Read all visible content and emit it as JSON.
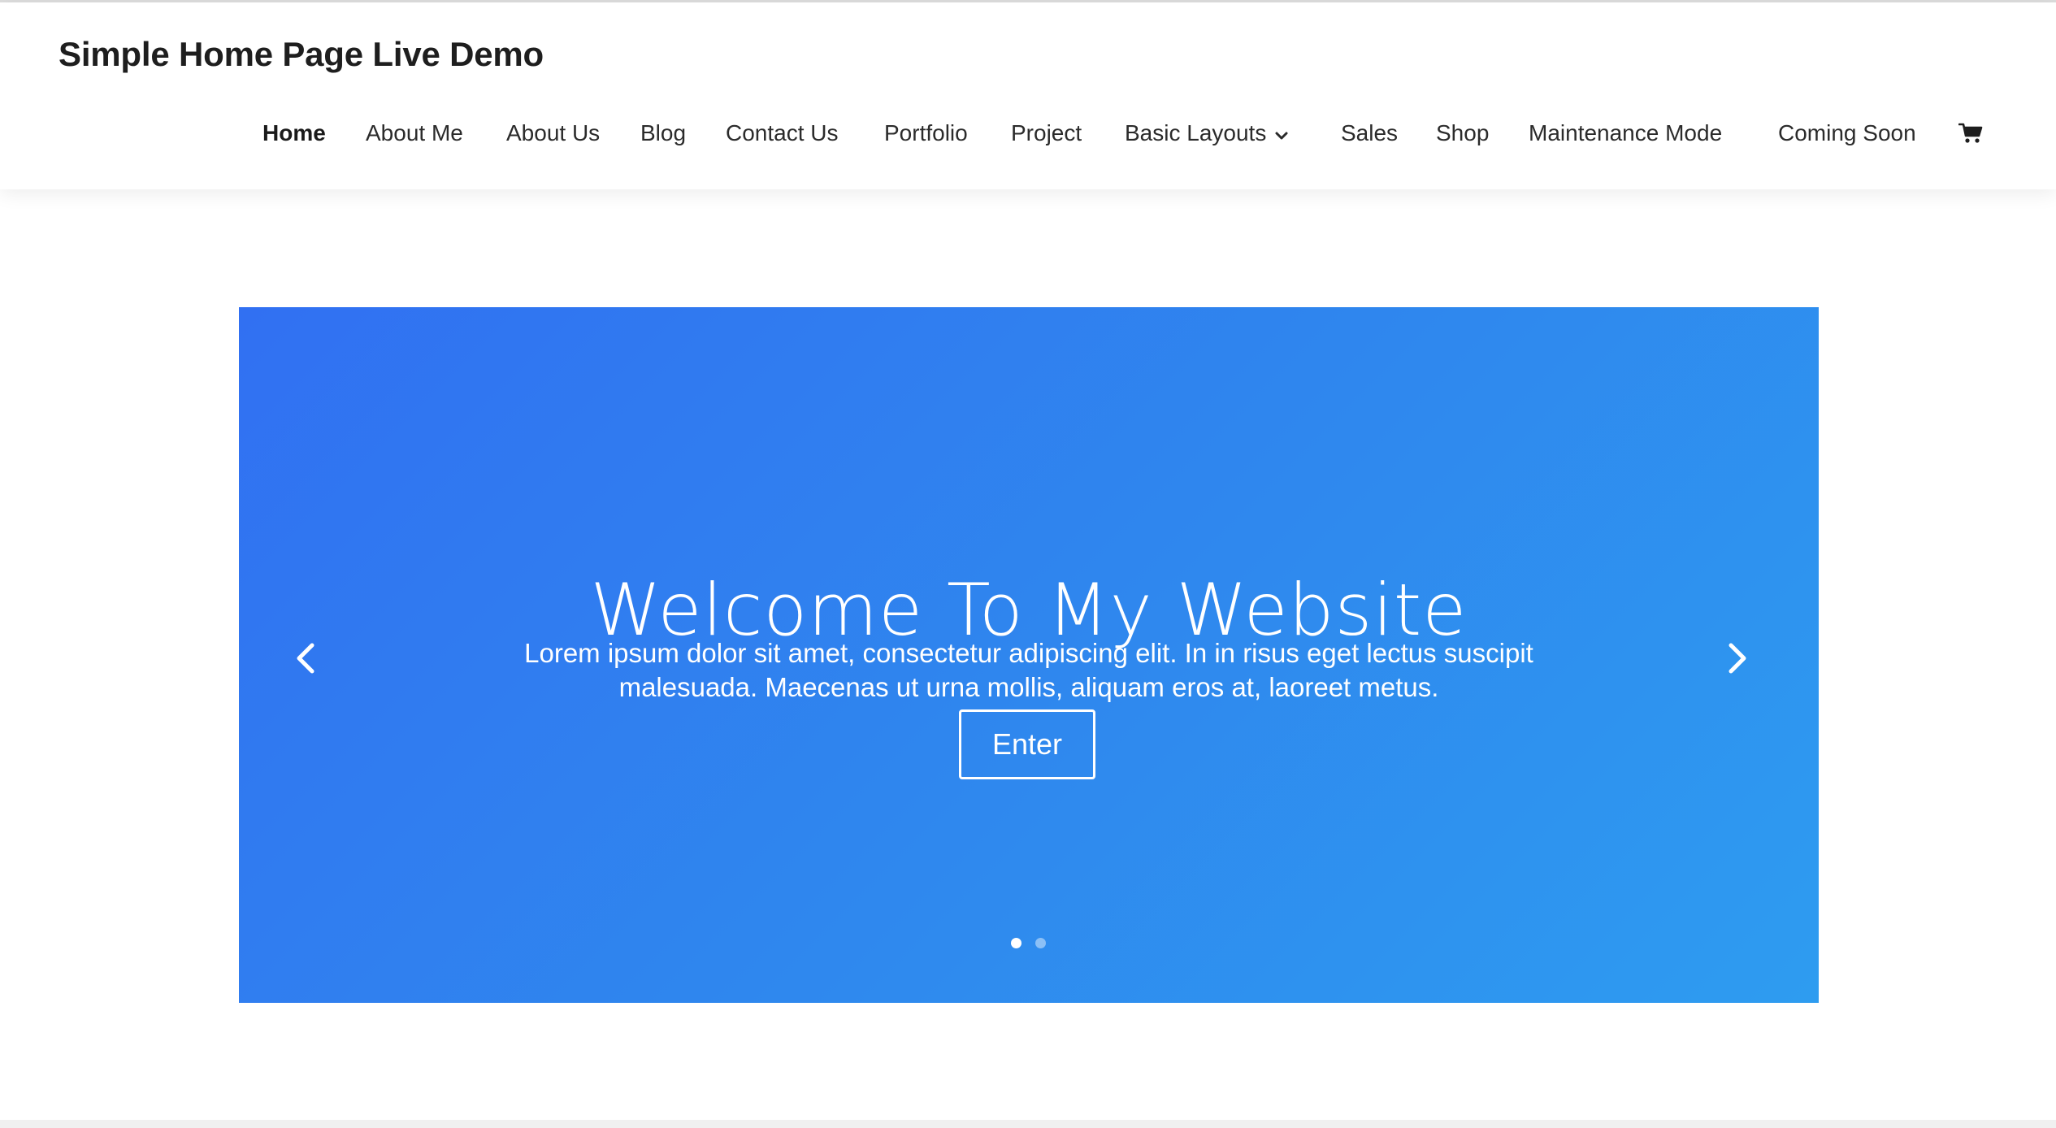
{
  "site": {
    "title": "Simple Home Page Live Demo"
  },
  "nav": {
    "items": [
      {
        "label": "Home",
        "active": true
      },
      {
        "label": "About Me"
      },
      {
        "label": "About Us"
      },
      {
        "label": "Blog"
      },
      {
        "label": "Contact Us"
      },
      {
        "label": "Portfolio"
      },
      {
        "label": "Project"
      },
      {
        "label": "Basic Layouts",
        "has_dropdown": true
      },
      {
        "label": "Sales"
      },
      {
        "label": "Shop"
      },
      {
        "label": "Maintenance Mode"
      },
      {
        "label": "Coming Soon"
      }
    ],
    "cart_icon": "cart-icon",
    "dropdown_icon": "chevron-down-icon"
  },
  "hero": {
    "title": "Welcome To My Website",
    "text": "Lorem ipsum dolor sit amet, consectetur adipiscing elit. In in risus eget lectus suscipit malesuada. Maecenas ut urna mollis, aliquam eros at, laoreet metus.",
    "button_label": "Enter",
    "prev_icon": "chevron-left-icon",
    "next_icon": "chevron-right-icon",
    "slide_count": 2,
    "active_slide": 1,
    "gradient_start": "#3170f2",
    "gradient_end": "#2e9cf0"
  },
  "colors": {
    "text_dark": "#1e1e1e",
    "background": "#ffffff"
  }
}
